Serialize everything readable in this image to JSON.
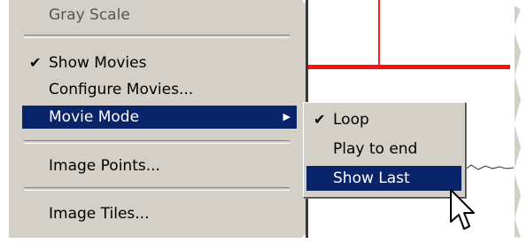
{
  "menu": {
    "items": [
      {
        "label": "Gray Scale",
        "checked": false
      },
      {
        "label": "Show Movies",
        "checked": true
      },
      {
        "label": "Configure Movies...",
        "checked": false
      },
      {
        "label": "Movie Mode",
        "checked": false,
        "has_submenu": true,
        "selected": true
      },
      {
        "label": "Image Points...",
        "checked": false
      },
      {
        "label": "Image Tiles...",
        "checked": false
      }
    ],
    "check_glyph": "✔",
    "submenu_arrow": "▶"
  },
  "submenu": {
    "items": [
      {
        "label": "Loop",
        "checked": true
      },
      {
        "label": "Play to end",
        "checked": false
      },
      {
        "label": "Show Last",
        "checked": false,
        "selected": true
      }
    ]
  },
  "colors": {
    "menu_bg": "#d4d0c8",
    "highlight": "#0a246a",
    "plot_line": "#ff1010"
  }
}
